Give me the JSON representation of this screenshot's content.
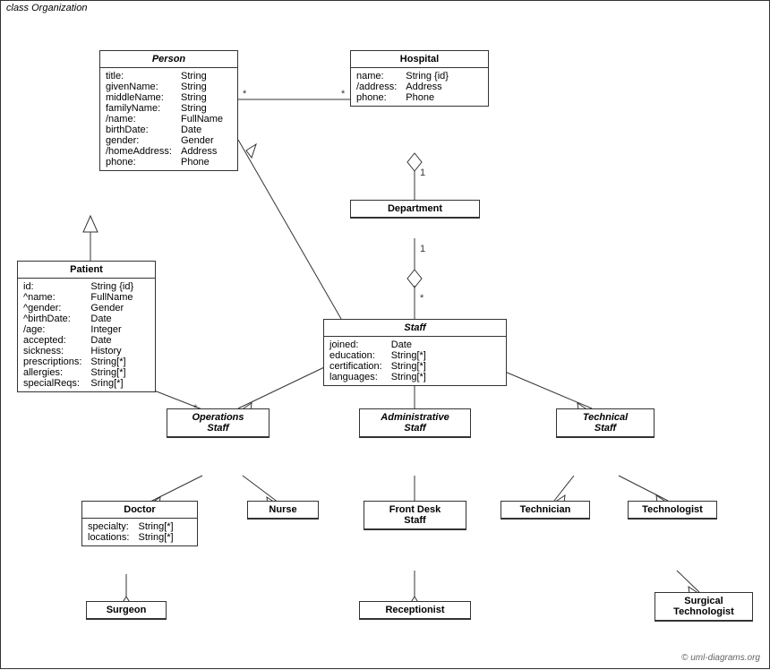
{
  "diagram": {
    "title": "class Organization",
    "classes": {
      "person": {
        "name": "Person",
        "italic": true,
        "attributes": [
          {
            "name": "title:",
            "type": "String"
          },
          {
            "name": "givenName:",
            "type": "String"
          },
          {
            "name": "middleName:",
            "type": "String"
          },
          {
            "name": "familyName:",
            "type": "String"
          },
          {
            "name": "/name:",
            "type": "FullName"
          },
          {
            "name": "birthDate:",
            "type": "Date"
          },
          {
            "name": "gender:",
            "type": "Gender"
          },
          {
            "name": "/homeAddress:",
            "type": "Address"
          },
          {
            "name": "phone:",
            "type": "Phone"
          }
        ]
      },
      "hospital": {
        "name": "Hospital",
        "attributes": [
          {
            "name": "name:",
            "type": "String {id}"
          },
          {
            "name": "/address:",
            "type": "Address"
          },
          {
            "name": "phone:",
            "type": "Phone"
          }
        ]
      },
      "patient": {
        "name": "Patient",
        "attributes": [
          {
            "name": "id:",
            "type": "String {id}"
          },
          {
            "name": "^name:",
            "type": "FullName"
          },
          {
            "name": "^gender:",
            "type": "Gender"
          },
          {
            "name": "^birthDate:",
            "type": "Date"
          },
          {
            "name": "/age:",
            "type": "Integer"
          },
          {
            "name": "accepted:",
            "type": "Date"
          },
          {
            "name": "sickness:",
            "type": "History"
          },
          {
            "name": "prescriptions:",
            "type": "String[*]"
          },
          {
            "name": "allergies:",
            "type": "String[*]"
          },
          {
            "name": "specialReqs:",
            "type": "Sring[*]"
          }
        ]
      },
      "department": {
        "name": "Department"
      },
      "staff": {
        "name": "Staff",
        "italic": true,
        "attributes": [
          {
            "name": "joined:",
            "type": "Date"
          },
          {
            "name": "education:",
            "type": "String[*]"
          },
          {
            "name": "certification:",
            "type": "String[*]"
          },
          {
            "name": "languages:",
            "type": "String[*]"
          }
        ]
      },
      "operations_staff": {
        "name": "Operations Staff",
        "italic": true
      },
      "administrative_staff": {
        "name": "Administrative Staff",
        "italic": true
      },
      "technical_staff": {
        "name": "Technical Staff",
        "italic": true
      },
      "doctor": {
        "name": "Doctor",
        "attributes": [
          {
            "name": "specialty:",
            "type": "String[*]"
          },
          {
            "name": "locations:",
            "type": "String[*]"
          }
        ]
      },
      "nurse": {
        "name": "Nurse"
      },
      "front_desk_staff": {
        "name": "Front Desk Staff"
      },
      "technician": {
        "name": "Technician"
      },
      "technologist": {
        "name": "Technologist"
      },
      "surgeon": {
        "name": "Surgeon"
      },
      "receptionist": {
        "name": "Receptionist"
      },
      "surgical_technologist": {
        "name": "Surgical Technologist"
      }
    },
    "copyright": "© uml-diagrams.org"
  }
}
